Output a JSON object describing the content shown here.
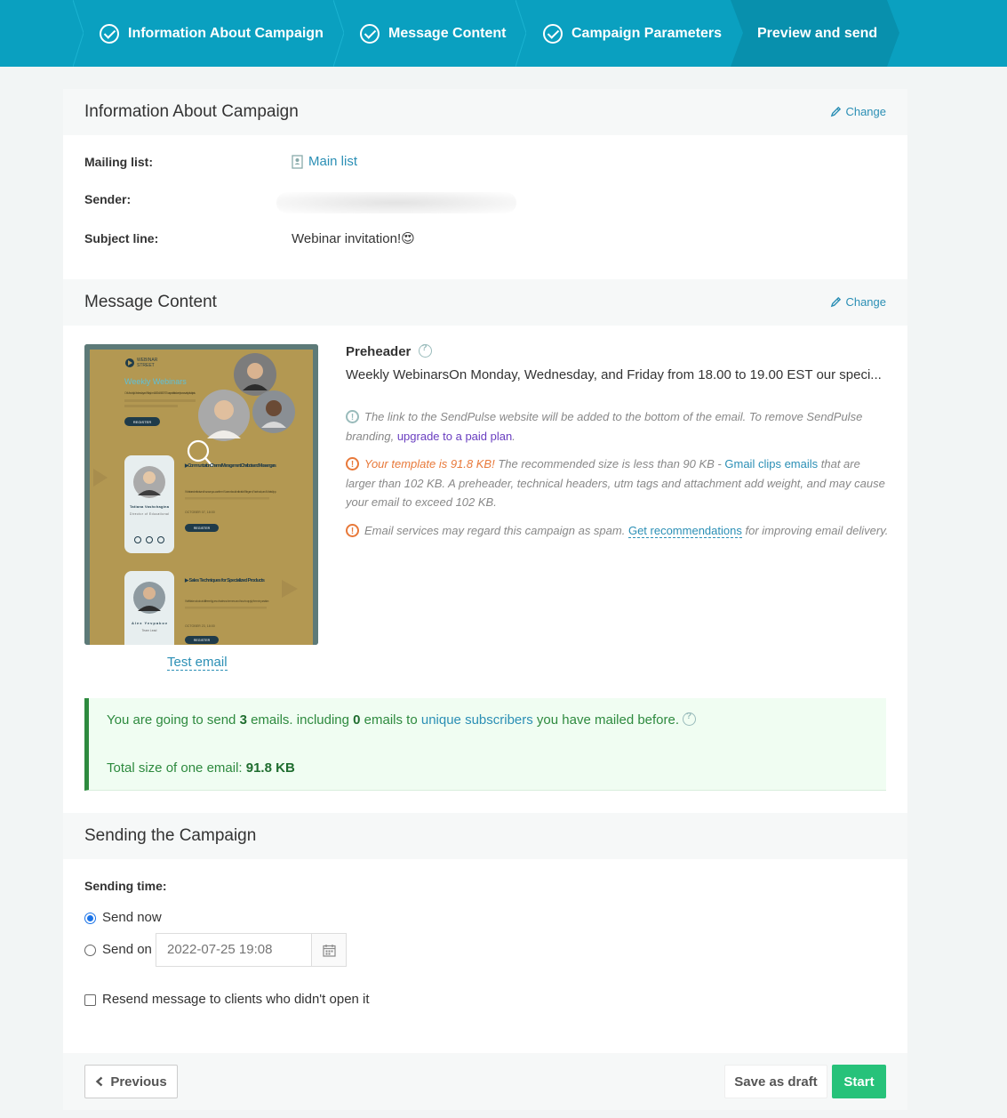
{
  "stepper": {
    "steps": [
      {
        "label": "Information About Campaign",
        "done": true
      },
      {
        "label": "Message Content",
        "done": true
      },
      {
        "label": "Campaign Parameters",
        "done": true
      },
      {
        "label": "Preview and send",
        "done": false,
        "active": true
      }
    ]
  },
  "info_section": {
    "title": "Information About Campaign",
    "change_label": "Change",
    "mailing_list_label": "Mailing list:",
    "mailing_list_value": "Main list",
    "sender_label": "Sender:",
    "subject_label": "Subject line:",
    "subject_value": "Webinar invitation!😍"
  },
  "content_section": {
    "title": "Message Content",
    "change_label": "Change",
    "test_email": "Test email",
    "preheader_title": "Preheader",
    "preheader_text": "Weekly WebinarsOn Monday, Wednesday, and Friday from 18.00 to 19.00 EST our speci...",
    "note1_text": "The link to the SendPulse website will be added to the bottom of the email. To remove SendPulse branding, ",
    "note1_link": "upgrade to a paid plan",
    "note1_end": ".",
    "note2_highlight": "Your template is 91.8 KB!",
    "note2_text": " The recommended size is less than 90 KB - ",
    "note2_link": "Gmail clips emails",
    "note2_end": " that are larger than 102 KB. A preheader, technical headers, utm tags and attachment add weight, and may cause your email to exceed 102 KB.",
    "note3_text": "Email services may regard this campaign as spam. ",
    "note3_link": "Get recommendations",
    "note3_end": " for improving email delivery."
  },
  "summary": {
    "pre": "You are going to send ",
    "count": "3",
    "mid": " emails.  including ",
    "zero": "0",
    "mid2": " emails to ",
    "link": "unique subscribers",
    "post": " you have mailed before.",
    "size_label": "Total size of one email: ",
    "size_value": "91.8 KB"
  },
  "sending_section": {
    "title": "Sending the Campaign",
    "time_label": "Sending time:",
    "send_now": "Send now",
    "send_on": "Send on",
    "date_placeholder": "2022-07-25 19:08",
    "resend": "Resend message to clients who didn't open it"
  },
  "footer": {
    "previous": "Previous",
    "draft": "Save as draft",
    "start": "Start"
  },
  "preview_text": {
    "brand_top": "WEBINAR",
    "brand_bottom": "STREET",
    "heading": "Weekly Webinars",
    "intro": "On Monday, Wednesday, and Friday from 18.00 to 19.00 EST our specialists share tips on a variety of subjects.",
    "register": "REGISTER",
    "topic1": "▶ Communication Channel Management: Chatbots and Messengers",
    "topic1_desc": "What are chatbots and how can you use them? Learn about chatbots for Telegram, Facebook, and WhatsApp.",
    "topic1_date": "OCTOBER 07, 18:00",
    "speaker1_name": "Tatiana Vashchagina",
    "speaker1_role": "Director of Educational",
    "topic2": "▶ Sales Techniques for Specialized Products",
    "topic2_desc": "We'll take a look at different types of sales schemes and how to apply them in practice.",
    "topic2_date": "OCTOBER 23, 18:00",
    "speaker2_name": "Alex Yevpakov",
    "speaker2_role": "Team Lead"
  },
  "colors": {
    "header": "#0aa0c0",
    "accent": "#2b8fb5",
    "success": "#2d8a3e",
    "start": "#27c27a",
    "warning": "#e8793a"
  }
}
